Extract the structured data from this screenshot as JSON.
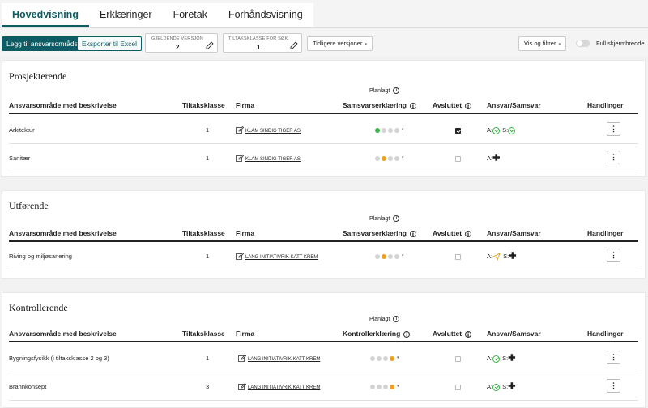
{
  "tabs": [
    "Hovedvisning",
    "Erklæringer",
    "Foretak",
    "Forhåndsvisning"
  ],
  "toolbar": {
    "add_label": "Legg til ansvarsområde",
    "export_label": "Eksporter til Excel",
    "current_version_label": "GJELDENDE VERSJON",
    "current_version_value": "2",
    "class_label": "TILTAKSKLASSE FOR SØK",
    "class_value": "1",
    "prev_versions": "Tidligere versjoner",
    "view_filter": "Vis og filtrer",
    "fullwidth": "Full skjermbredde"
  },
  "planlagt": "Planlagt",
  "headers": {
    "area": "Ansvarsområde med beskrivelse",
    "class": "Tiltaksklasse",
    "firm": "Firma",
    "samsvar": "Samsvarserklæring",
    "kontroll": "Kontrollerklæring",
    "done": "Avsluttet",
    "resp": "Ansvar/Samsvar",
    "actions": "Handlinger"
  },
  "sections": [
    {
      "title": "Prosjekterende",
      "rows": [
        {
          "area": "Arkitektur",
          "class": "1",
          "firm": "KLAM SINDIG TIGER AS",
          "dots": [
            "g",
            "n",
            "n",
            "n"
          ],
          "done": true,
          "a": "check",
          "s": "check"
        },
        {
          "area": "Sanitær",
          "class": "1",
          "firm": "KLAM SINDIG TIGER AS",
          "dots": [
            "n",
            "o",
            "n",
            "n"
          ],
          "done": false,
          "a": "plus",
          "s": null
        }
      ]
    },
    {
      "title": "Utførende",
      "rows": [
        {
          "area": "Riving og miljøsanering",
          "class": "1",
          "firm": "LANG INITIATIVRIK KATT KREM",
          "dots": [
            "n",
            "o",
            "n",
            "n"
          ],
          "done": false,
          "a": "send",
          "s": "plus"
        }
      ]
    },
    {
      "title": "Kontrollerende",
      "rows": [
        {
          "area": "Bygningsfysikk (i tiltaksklasse 2 og 3)",
          "class": "1",
          "firm": "LANG INITIATIVRIK KATT KREM",
          "dots": [
            "n",
            "n",
            "n",
            "o"
          ],
          "done": false,
          "a": "check",
          "s": "plus"
        },
        {
          "area": "Brannkonsept",
          "class": "3",
          "firm": "LANG INITIATIVRIK KATT KREM",
          "dots": [
            "n",
            "n",
            "n",
            "o"
          ],
          "done": false,
          "a": "check",
          "s": "plus"
        }
      ]
    }
  ],
  "labels": {
    "a": "A:",
    "s": "S:"
  }
}
